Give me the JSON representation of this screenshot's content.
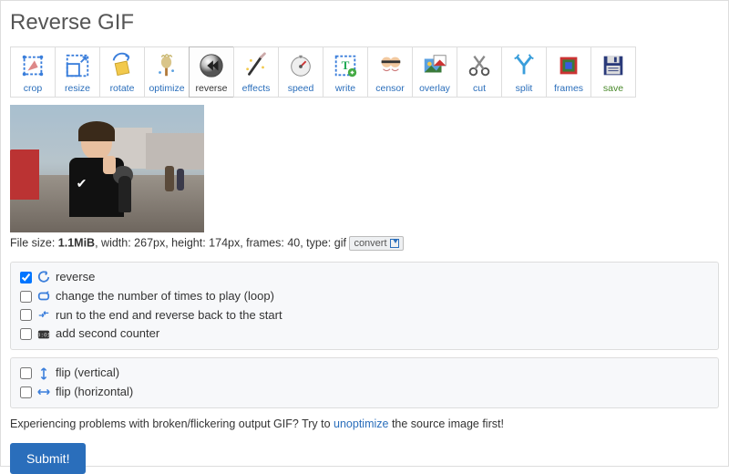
{
  "title": "Reverse GIF",
  "toolbar": [
    {
      "id": "crop",
      "label": "crop"
    },
    {
      "id": "resize",
      "label": "resize"
    },
    {
      "id": "rotate",
      "label": "rotate"
    },
    {
      "id": "optimize",
      "label": "optimize"
    },
    {
      "id": "reverse",
      "label": "reverse",
      "active": true
    },
    {
      "id": "effects",
      "label": "effects"
    },
    {
      "id": "speed",
      "label": "speed"
    },
    {
      "id": "write",
      "label": "write"
    },
    {
      "id": "censor",
      "label": "censor"
    },
    {
      "id": "overlay",
      "label": "overlay"
    },
    {
      "id": "cut",
      "label": "cut"
    },
    {
      "id": "split",
      "label": "split"
    },
    {
      "id": "frames",
      "label": "frames"
    },
    {
      "id": "save",
      "label": "save"
    }
  ],
  "file": {
    "prefix": "File size: ",
    "size": "1.1MiB",
    "rest": ", width: 267px, height: 174px, frames: 40, type: gif",
    "convert_label": "convert"
  },
  "options_a": [
    {
      "id": "reverse",
      "label": "reverse",
      "checked": true,
      "icon": "reverse"
    },
    {
      "id": "loop",
      "label": "change the number of times to play (loop)",
      "checked": false,
      "icon": "loop"
    },
    {
      "id": "runback",
      "label": "run to the end and reverse back to the start",
      "checked": false,
      "icon": "runback"
    },
    {
      "id": "counter",
      "label": "add second counter",
      "checked": false,
      "icon": "counter"
    }
  ],
  "options_b": [
    {
      "id": "flipv",
      "label": "flip (vertical)",
      "checked": false,
      "icon": "flipv"
    },
    {
      "id": "fliph",
      "label": "flip (horizontal)",
      "checked": false,
      "icon": "fliph"
    }
  ],
  "help": {
    "before": "Experiencing problems with broken/flickering output GIF? Try to ",
    "link": "unoptimize",
    "after": " the source image first!"
  },
  "submit": "Submit!"
}
